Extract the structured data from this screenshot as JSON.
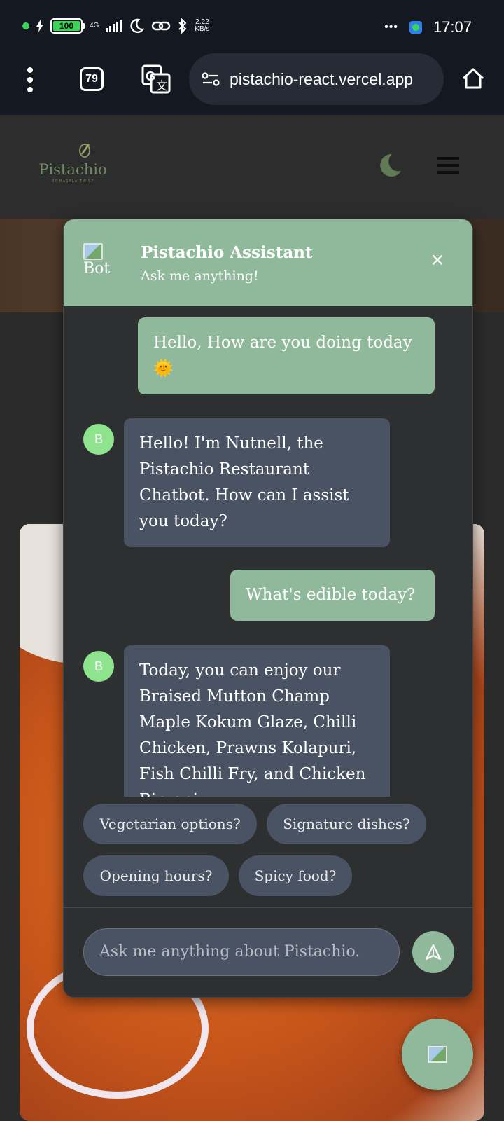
{
  "status": {
    "battery": "100",
    "network": "4G",
    "speed_value": "2.22",
    "speed_unit": "KB/s",
    "overflow": "•••",
    "time": "17:07"
  },
  "browser": {
    "tab_count": "79",
    "url": "pistachio-react.vercel.app"
  },
  "site": {
    "logo_name": "Pistachio",
    "logo_sub": "BY MASALA TWIST"
  },
  "chat": {
    "title": "Pistachio Assistant",
    "subtitle": "Ask me anything!",
    "close_label": "×",
    "bot_img_alt": "Bot",
    "avatar_letter": "B",
    "messages": [
      {
        "role": "user",
        "text": "Hello, How are you doing today 🌞"
      },
      {
        "role": "bot",
        "text": "Hello! I'm Nutnell, the Pistachio Restaurant Chatbot. How can I assist you today?"
      },
      {
        "role": "user",
        "text": "What's edible today?"
      },
      {
        "role": "bot",
        "text": "Today, you can enjoy our Braised Mutton Champ Maple Kokum Glaze, Chilli Chicken, Prawns Kolapuri, Fish Chilli Fry, and Chicken Biryani."
      }
    ],
    "suggestions": [
      "Vegetarian options?",
      "Signature dishes?",
      "Opening hours?",
      "Spicy food?"
    ],
    "input_placeholder": "Ask me anything about Pistachio."
  },
  "colors": {
    "accent": "#8fb99a",
    "bot_bubble": "#4a5363",
    "panel": "#2e2f31"
  }
}
